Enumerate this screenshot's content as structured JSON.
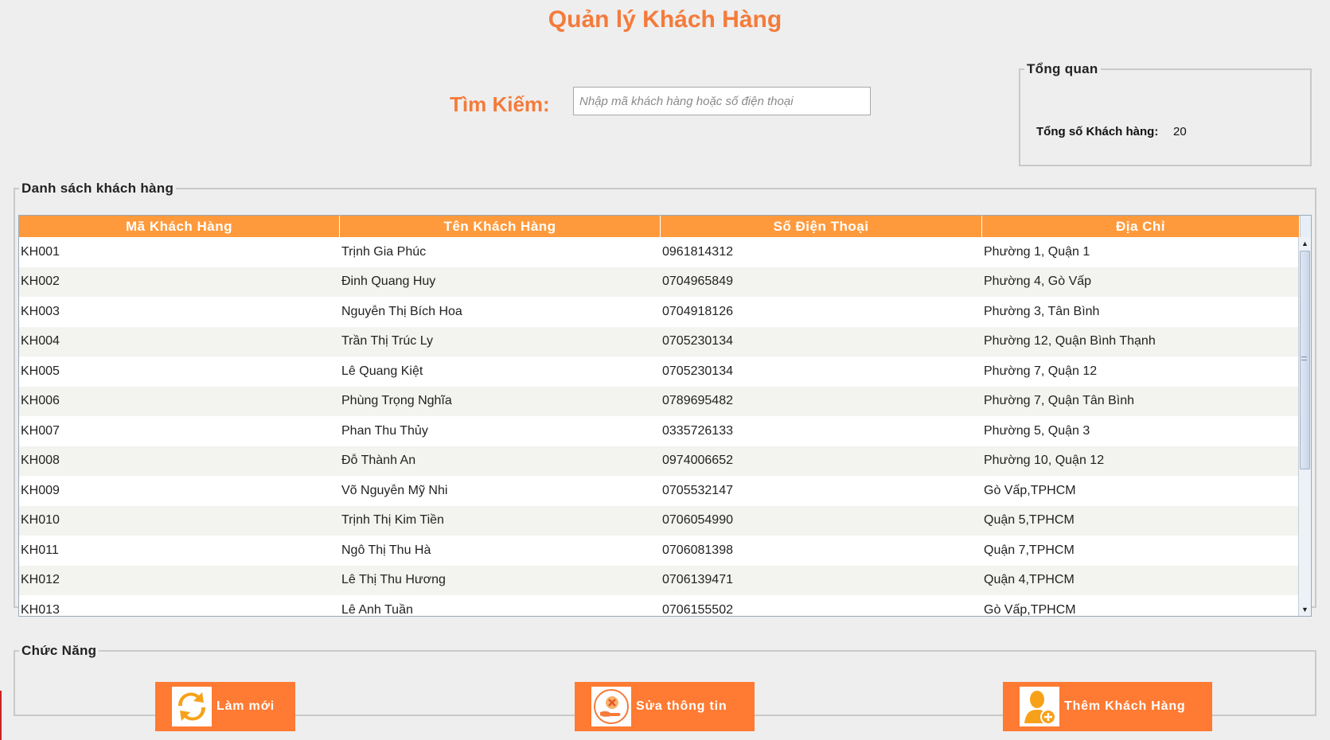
{
  "title": "Quản lý Khách Hàng",
  "search": {
    "label": "Tìm Kiếm:",
    "placeholder": "Nhập mã khách hàng hoặc số điện thoại",
    "value": ""
  },
  "overview": {
    "legend": "Tổng quan",
    "total_label": "Tổng số Khách hàng:",
    "total_value": "20"
  },
  "customers": {
    "legend": "Danh sách khách hàng",
    "columns": [
      "Mã Khách Hàng",
      "Tên Khách Hàng",
      "Số Điện Thoại",
      "Địa Chỉ"
    ],
    "rows": [
      [
        "KH001",
        "Trịnh Gia Phúc",
        "0961814312",
        "Phường 1, Quận 1"
      ],
      [
        "KH002",
        "Đinh Quang Huy",
        "0704965849",
        "Phường 4, Gò Vấp"
      ],
      [
        "KH003",
        "Nguyễn Thị Bích Hoa",
        "0704918126",
        "Phường 3, Tân Bình"
      ],
      [
        "KH004",
        "Trần Thị Trúc Ly",
        "0705230134",
        "Phường 12, Quận Bình Thạnh"
      ],
      [
        "KH005",
        "Lê Quang Kiệt",
        "0705230134",
        "Phường 7, Quận 12"
      ],
      [
        "KH006",
        "Phùng Trọng Nghĩa",
        "0789695482",
        "Phường 7, Quận Tân Bình"
      ],
      [
        "KH007",
        "Phan Thu Thủy",
        "0335726133",
        "Phường 5, Quận 3"
      ],
      [
        "KH008",
        "Đỗ Thành An",
        "0974006652",
        "Phường 10, Quận 12"
      ],
      [
        "KH009",
        "Võ Nguyễn Mỹ Nhi",
        "0705532147",
        "Gò Vấp,TPHCM"
      ],
      [
        "KH010",
        "Trịnh Thị Kim Tiền",
        "0706054990",
        "Quận 5,TPHCM"
      ],
      [
        "KH011",
        "Ngô Thị Thu Hà",
        "0706081398",
        "Quận 7,TPHCM"
      ],
      [
        "KH012",
        "Lê Thị Thu Hương",
        "0706139471",
        "Quận 4,TPHCM"
      ],
      [
        "KH013",
        "Lê Anh Tuần",
        "0706155502",
        "Gò Vấp,TPHCM"
      ]
    ]
  },
  "functions": {
    "legend": "Chức Năng",
    "refresh_label": "Làm mới",
    "edit_label": "Sửa thông tin",
    "add_label": "Thêm Khách Hàng"
  },
  "colors": {
    "accent": "#f47b3a",
    "header_bg": "#ff9a3c",
    "button_bg": "#ff7a32"
  },
  "icons": {
    "refresh": "refresh-arrows-icon",
    "edit": "edit-hand-icon",
    "add": "add-user-icon"
  }
}
